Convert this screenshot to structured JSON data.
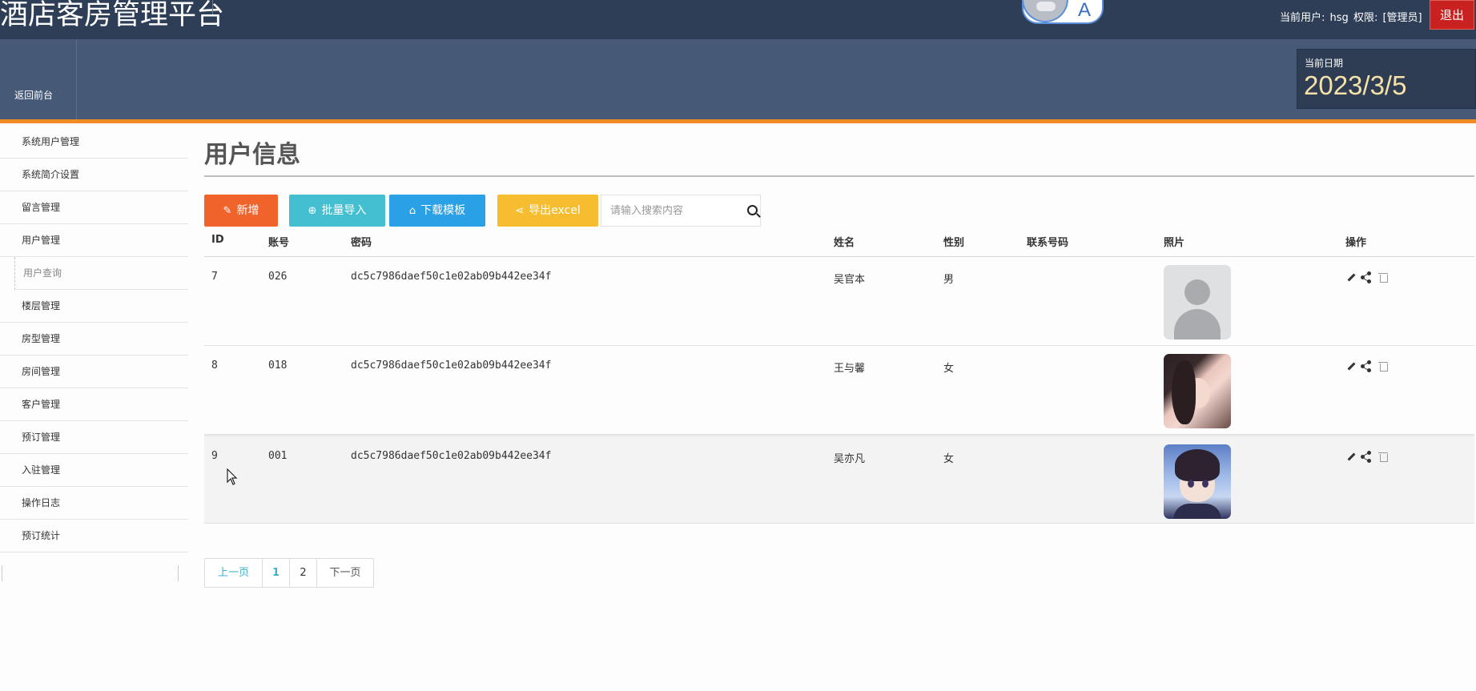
{
  "header": {
    "app_title": "酒店客房管理平台",
    "lang_toggle_label": "A",
    "current_user_label": "当前用户:",
    "current_user": "hsg",
    "role_label": "权限:",
    "role": "[管理员]",
    "logout": "退出"
  },
  "navbar": {
    "back_to_front": "返回前台",
    "date_label": "当前日期",
    "date_value": "2023/3/5"
  },
  "sidebar": {
    "items": [
      {
        "label": "系统用户管理"
      },
      {
        "label": "系统简介设置"
      },
      {
        "label": "留言管理"
      },
      {
        "label": "用户管理"
      },
      {
        "label": "用户查询"
      },
      {
        "label": "楼层管理"
      },
      {
        "label": "房型管理"
      },
      {
        "label": "房间管理"
      },
      {
        "label": "客户管理"
      },
      {
        "label": "预订管理"
      },
      {
        "label": "入驻管理"
      },
      {
        "label": "操作日志"
      },
      {
        "label": "预订统计"
      }
    ]
  },
  "main": {
    "title": "用户信息",
    "toolbar": {
      "add": "新增",
      "batch_import": "批量导入",
      "download_template": "下载模板",
      "export_excel": "导出excel",
      "search_placeholder": "请输入搜索内容"
    },
    "table": {
      "headers": [
        "ID",
        "账号",
        "密码",
        "姓名",
        "性别",
        "联系号码",
        "照片",
        "操作"
      ],
      "rows": [
        {
          "id": "7",
          "account": "026",
          "password": "dc5c7986daef50c1e02ab09b442ee34f",
          "name": "吴官本",
          "sex": "男",
          "phone": "",
          "photo": "default-avatar"
        },
        {
          "id": "8",
          "account": "018",
          "password": "dc5c7986daef50c1e02ab09b442ee34f",
          "name": "王与馨",
          "sex": "女",
          "phone": "",
          "photo": "girl-portrait"
        },
        {
          "id": "9",
          "account": "001",
          "password": "dc5c7986daef50c1e02ab09b442ee34f",
          "name": "吴亦凡",
          "sex": "女",
          "phone": "",
          "photo": "anime-boy-portrait"
        }
      ]
    },
    "pagination": {
      "prev": "上一页",
      "pages": [
        "1",
        "2"
      ],
      "current": "1",
      "next": "下一页"
    }
  },
  "colors": {
    "topbar": "#2f3e57",
    "navbar": "#465a78",
    "accent_line": "#f08a24",
    "logout": "#c9211f",
    "btn_add": "#f0632b",
    "btn_import": "#44bfd2",
    "btn_template": "#2aa0e7",
    "btn_export": "#f6bd30"
  }
}
